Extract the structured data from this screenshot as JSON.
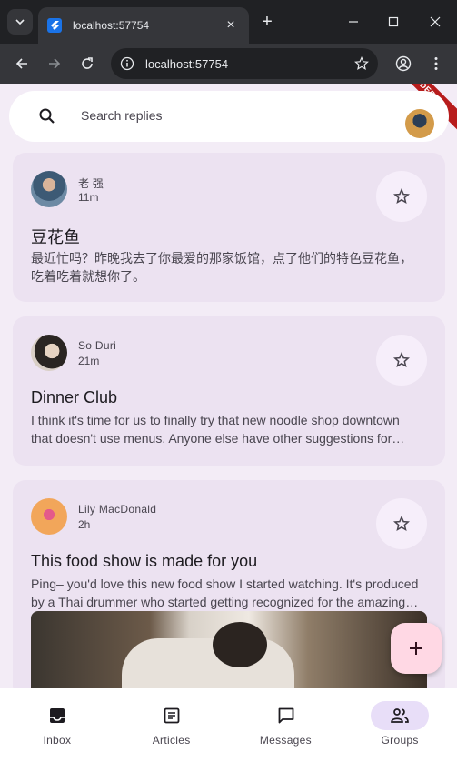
{
  "browser": {
    "tab_title": "localhost:57754",
    "url": "localhost:57754"
  },
  "search": {
    "placeholder": "Search replies"
  },
  "debug_label": "DEBUG",
  "emails": [
    {
      "sender": "老 强",
      "time": "11m",
      "subject": "豆花鱼",
      "body": "最近忙吗？昨晚我去了你最爱的那家饭馆，点了他们的特色豆花鱼，吃着吃着就想你了。"
    },
    {
      "sender": "So Duri",
      "time": "21m",
      "subject": "Dinner Club",
      "body": "I think it's time for us to finally try that new noodle shop downtown that doesn't use menus. Anyone else have other suggestions for dinner club this week? I'm so intrigued by this idea of a noodle restaurant where no one gets to order for themselves."
    },
    {
      "sender": "Lily MacDonald",
      "time": "2h",
      "subject": "This food show is made for you",
      "body": "Ping– you'd love this new food show I started watching. It's produced by a Thai drummer who started getting recognized for the amazing vegan food she always brought to shows."
    }
  ],
  "nav": [
    {
      "label": "Inbox",
      "icon": "inbox-icon",
      "active": false
    },
    {
      "label": "Articles",
      "icon": "article-icon",
      "active": false
    },
    {
      "label": "Messages",
      "icon": "chat-icon",
      "active": false
    },
    {
      "label": "Groups",
      "icon": "group-icon",
      "active": true
    }
  ],
  "colors": {
    "background": "#f3ecf6",
    "card": "#ece2f1",
    "fab": "#ffd8e4",
    "nav_active": "#e8def8"
  }
}
